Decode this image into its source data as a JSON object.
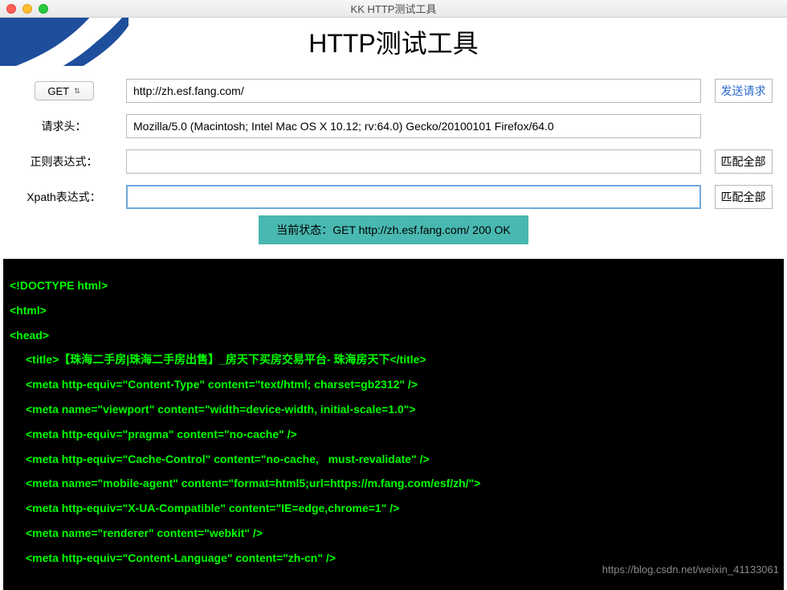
{
  "window": {
    "title": "KK HTTP测试工具"
  },
  "banner": {
    "title": "HTTP测试工具"
  },
  "controls": {
    "method": "GET",
    "url": "http://zh.esf.fang.com/",
    "send_label": "发送请求",
    "headers_label": "请求头：",
    "headers_value": "Mozilla/5.0 (Macintosh; Intel Mac OS X 10.12; rv:64.0) Gecko/20100101 Firefox/64.0",
    "regex_label": "正则表达式：",
    "regex_value": "",
    "regex_btn": "匹配全部",
    "xpath_label": "Xpath表达式：",
    "xpath_value": "",
    "xpath_btn": "匹配全部"
  },
  "status": {
    "text": "当前状态：GET http://zh.esf.fang.com/    200 OK"
  },
  "code": {
    "lines": [
      {
        "text": "<!DOCTYPE html>",
        "indent": 0
      },
      {
        "text": "<html>",
        "indent": 0
      },
      {
        "text": "<head>",
        "indent": 0
      },
      {
        "text": "<title>【珠海二手房|珠海二手房出售】_房天下买房交易平台- 珠海房天下</title>",
        "indent": 1
      },
      {
        "text": "<meta http-equiv=\"Content-Type\" content=\"text/html; charset=gb2312\" />",
        "indent": 1
      },
      {
        "text": "<meta name=\"viewport\" content=\"width=device-width, initial-scale=1.0\">",
        "indent": 1
      },
      {
        "text": "<meta http-equiv=\"pragma\" content=\"no-cache\" />",
        "indent": 1
      },
      {
        "text": "<meta http-equiv=\"Cache-Control\" content=\"no-cache,   must-revalidate\" />",
        "indent": 1
      },
      {
        "text": "<meta name=\"mobile-agent\" content=\"format=html5;url=https://m.fang.com/esf/zh/\">",
        "indent": 1
      },
      {
        "text": "<meta http-equiv=\"X-UA-Compatible\" content=\"IE=edge,chrome=1\" />",
        "indent": 1
      },
      {
        "text": "<meta name=\"renderer\" content=\"webkit\" />",
        "indent": 1
      },
      {
        "text": "<meta http-equiv=\"Content-Language\" content=\"zh-cn\" />",
        "indent": 1
      }
    ]
  },
  "watermark": "https://blog.csdn.net/weixin_41133061"
}
